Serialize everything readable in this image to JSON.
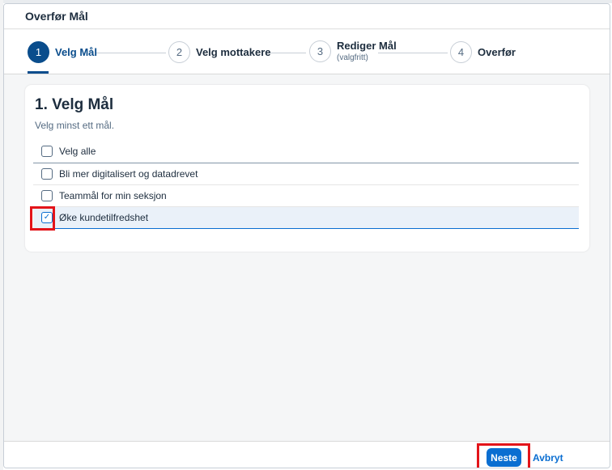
{
  "dialog": {
    "title": "Overfør Mål"
  },
  "stepper": {
    "steps": [
      {
        "number": "1",
        "label": "Velg Mål",
        "sub": ""
      },
      {
        "number": "2",
        "label": "Velg mottakere",
        "sub": ""
      },
      {
        "number": "3",
        "label": "Rediger Mål",
        "sub": "(valgfritt)"
      },
      {
        "number": "4",
        "label": "Overfør",
        "sub": ""
      }
    ],
    "active_step": 1
  },
  "card": {
    "title": "1. Velg Mål",
    "subtitle": "Velg minst ett mål.",
    "select_all_label": "Velg alle",
    "goals": [
      {
        "label": "Bli mer digitalisert og datadrevet",
        "checked": false
      },
      {
        "label": "Teammål for min seksjon",
        "checked": false
      },
      {
        "label": "Øke kundetilfredshet",
        "checked": true
      }
    ]
  },
  "footer": {
    "next_label": "Neste",
    "cancel_label": "Avbryt"
  },
  "icons": {
    "check": "checkmark-icon"
  },
  "colors": {
    "accent": "#0a6ed1",
    "active_step": "#0a4d8c",
    "highlight": "#e3141a"
  }
}
